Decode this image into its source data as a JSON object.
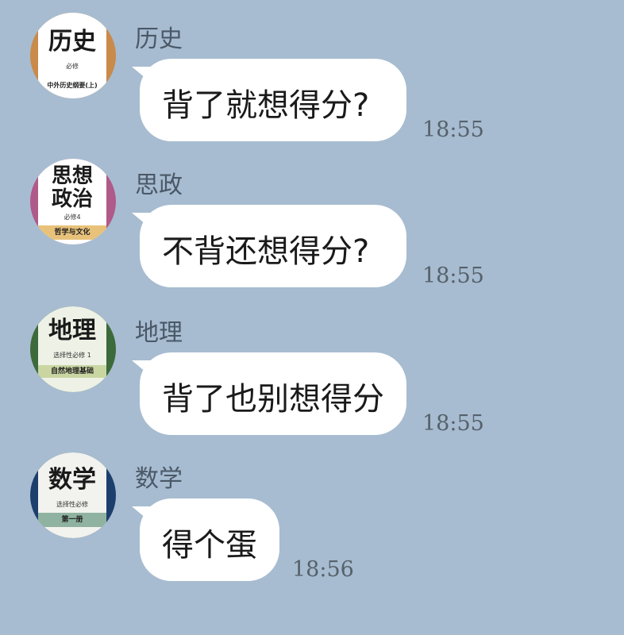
{
  "messages": [
    {
      "sender": "历史",
      "text": "背了就想得分?",
      "time": "18:55",
      "avatar": {
        "title": "历史",
        "subtitle": "必修",
        "band": "中外历史纲要(上)",
        "bg_color": "#c98a4a",
        "band_color": "#ffffff"
      }
    },
    {
      "sender": "思政",
      "text": "不背还想得分?",
      "time": "18:55",
      "avatar": {
        "title": "思想政治",
        "subtitle": "必修4",
        "band": "哲学与文化",
        "bg_color": "#b05a8a",
        "band_color": "#e8c27a"
      }
    },
    {
      "sender": "地理",
      "text": "背了也别想得分",
      "time": "18:55",
      "avatar": {
        "title": "地理",
        "subtitle": "选择性必修 1",
        "band": "自然地理基础",
        "bg_color": "#3d6a3a",
        "band_color": "#c9d6a2"
      }
    },
    {
      "sender": "数学",
      "text": "得个蛋",
      "time": "18:56",
      "avatar": {
        "title": "数学",
        "subtitle": "选择性必修",
        "band": "第一册",
        "bg_color": "#1d3f6e",
        "band_color": "#8fb3a0"
      }
    }
  ]
}
